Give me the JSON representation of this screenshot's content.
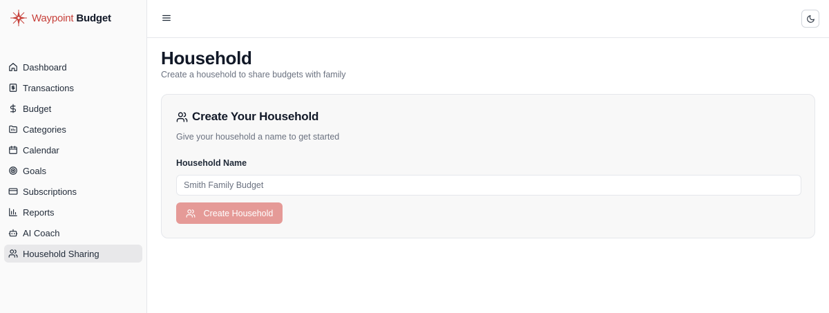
{
  "brand": {
    "name_part1": "Waypoint",
    "name_part2": "Budget",
    "logo_icon": "compass-star-icon",
    "accent": "#c7413b"
  },
  "sidebar": {
    "items": [
      {
        "label": "Dashboard",
        "icon": "home-icon",
        "active": false
      },
      {
        "label": "Transactions",
        "icon": "receipt-icon",
        "active": false
      },
      {
        "label": "Budget",
        "icon": "dollar-icon",
        "active": false
      },
      {
        "label": "Categories",
        "icon": "folder-icon",
        "active": false
      },
      {
        "label": "Calendar",
        "icon": "calendar-icon",
        "active": false
      },
      {
        "label": "Goals",
        "icon": "target-icon",
        "active": false
      },
      {
        "label": "Subscriptions",
        "icon": "credit-card-icon",
        "active": false
      },
      {
        "label": "Reports",
        "icon": "bar-chart-icon",
        "active": false
      },
      {
        "label": "AI Coach",
        "icon": "bot-icon",
        "active": false
      },
      {
        "label": "Household Sharing",
        "icon": "users-icon",
        "active": true
      }
    ]
  },
  "topbar": {
    "menu_icon": "menu-icon",
    "theme_icon": "moon-icon"
  },
  "page": {
    "title": "Household",
    "subtitle": "Create a household to share budgets with family"
  },
  "card": {
    "icon": "users-icon",
    "title": "Create Your Household",
    "description": "Give your household a name to get started",
    "field_label": "Household Name",
    "field_value": "",
    "field_placeholder": "Smith Family Budget",
    "button_label": "Create Household",
    "button_color": "#e59a97"
  }
}
